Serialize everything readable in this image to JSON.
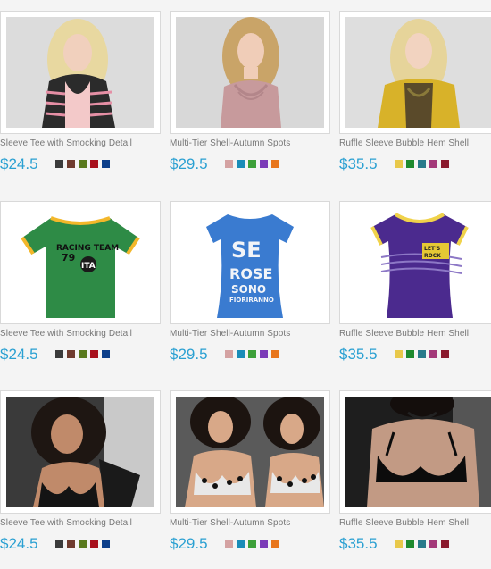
{
  "products": [
    {
      "name": "Sleeve Tee with Smocking Detail",
      "price": "$24.5",
      "image": "woman-striped-cardigan-photo",
      "colors": [
        "#3b3b3b",
        "#6e3b2e",
        "#5a7a1e",
        "#a8101c",
        "#0c3f8a"
      ]
    },
    {
      "name": "Multi-Tier Shell-Autumn Spots",
      "price": "$29.5",
      "image": "woman-pink-ruffle-top-photo",
      "colors": [
        "#d4a2a2",
        "#1a8cb8",
        "#3da039",
        "#7b3bb8",
        "#e8761c"
      ]
    },
    {
      "name": "Ruffle Sleeve Bubble Hem Shell",
      "price": "$35.5",
      "image": "woman-yellow-cardigan-photo",
      "colors": [
        "#e8c84a",
        "#1e8a2e",
        "#287a8a",
        "#a43a7a",
        "#8a1a2e"
      ]
    },
    {
      "name": "Sleeve Tee with Smocking Detail",
      "price": "$24.5",
      "image": "green-racing-team-tshirt-photo",
      "colors": [
        "#3b3b3b",
        "#6e3b2e",
        "#5a7a1e",
        "#a8101c",
        "#0c3f8a"
      ]
    },
    {
      "name": "Multi-Tier Shell-Autumn Spots",
      "price": "$29.5",
      "image": "blue-graphic-tshirt-photo",
      "colors": [
        "#d4a2a2",
        "#1a8cb8",
        "#3da039",
        "#7b3bb8",
        "#e8761c"
      ]
    },
    {
      "name": "Ruffle Sleeve Bubble Hem Shell",
      "price": "$35.5",
      "image": "purple-graphic-tshirt-photo",
      "colors": [
        "#e8c84a",
        "#1e8a2e",
        "#287a8a",
        "#a43a7a",
        "#8a1a2e"
      ]
    },
    {
      "name": "Sleeve Tee with Smocking Detail",
      "price": "$24.5",
      "image": "woman-black-lace-lingerie-photo",
      "colors": [
        "#3b3b3b",
        "#6e3b2e",
        "#5a7a1e",
        "#a8101c",
        "#0c3f8a"
      ]
    },
    {
      "name": "Multi-Tier Shell-Autumn Spots",
      "price": "$29.5",
      "image": "two-women-animal-print-lingerie-photo",
      "colors": [
        "#d4a2a2",
        "#1a8cb8",
        "#3da039",
        "#7b3bb8",
        "#e8761c"
      ]
    },
    {
      "name": "Ruffle Sleeve Bubble Hem Shell",
      "price": "$35.5",
      "image": "woman-black-bra-photo",
      "colors": [
        "#e8c84a",
        "#1e8a2e",
        "#287a8a",
        "#a43a7a",
        "#8a1a2e"
      ]
    }
  ],
  "tshirt_graphics": {
    "green": [
      "RACING TEAM",
      "79",
      "ITA"
    ],
    "blue": [
      "SE",
      "ROSE",
      "SONO",
      "FIORIRANNO"
    ],
    "purple": [
      "LET'S",
      "ROCK"
    ]
  }
}
